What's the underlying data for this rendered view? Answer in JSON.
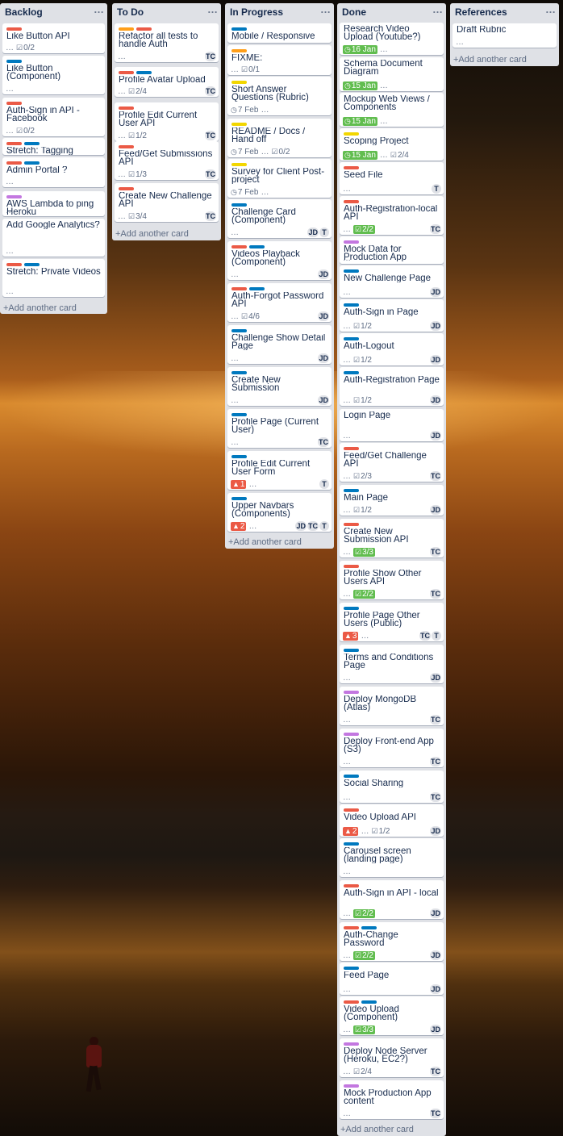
{
  "lists": [
    {
      "title": "Backlog",
      "add_label": "+Add another card",
      "cards": [
        {
          "title": "Like Button API",
          "checklist": "0/2",
          "labels": [
            "red"
          ]
        },
        {
          "title": "Like Button (Component)",
          "labels": [
            "blue"
          ]
        },
        {
          "title": "Auth-Sign in API - Facebook",
          "checklist": "0/2",
          "labels": [
            "red"
          ]
        },
        {
          "title": "Stretch: Tagging",
          "labels": [
            "red",
            "blue"
          ]
        },
        {
          "title": "Admin Portal ?",
          "labels": [
            "red",
            "blue"
          ]
        },
        {
          "title": "AWS Lambda to ping Heroku",
          "labels": [
            "purple"
          ]
        },
        {
          "title": "Add Google Analytics?",
          "labels": []
        },
        {
          "title": "Stretch: Private Videos",
          "labels": [
            "red",
            "blue"
          ]
        }
      ]
    },
    {
      "title": "To Do",
      "add_label": "+Add another card",
      "cards": [
        {
          "title": "Refactor all tests to handle Auth",
          "labels": [
            "orange",
            "red"
          ],
          "members": [
            "TC"
          ]
        },
        {
          "title": "Profile Avatar Upload",
          "checklist": "2/4",
          "labels": [
            "red",
            "blue"
          ],
          "members": [
            "TC"
          ]
        },
        {
          "title": "Profile Edit Current User API",
          "checklist": "1/2",
          "labels": [
            "red"
          ],
          "members": [
            "TC"
          ]
        },
        {
          "title": "Feed/Get Submissions API",
          "checklist": "1/3",
          "labels": [
            "red"
          ],
          "members": [
            "TC"
          ]
        },
        {
          "title": "Create New Challenge API",
          "checklist": "3/4",
          "labels": [
            "red"
          ],
          "members": [
            "TC"
          ]
        }
      ]
    },
    {
      "title": "In Progress",
      "add_label": "+Add another card",
      "cards": [
        {
          "title": "Mobile / Responsive",
          "labels": [
            "blue"
          ]
        },
        {
          "title": "FIXME:",
          "checklist": "0/1",
          "labels": [
            "orange"
          ]
        },
        {
          "title": "Short Answer Questions (Rubric)",
          "due": "7 Feb",
          "labels": [
            "yellow"
          ]
        },
        {
          "title": "README / Docs / Hand off",
          "due": "7 Feb",
          "checklist": "0/2",
          "labels": [
            "yellow"
          ]
        },
        {
          "title": "Survey for Client Post-project",
          "due": "7 Feb",
          "labels": [
            "yellow"
          ]
        },
        {
          "title": "Challenge Card (Component)",
          "labels": [
            "blue"
          ],
          "members": [
            "JD",
            "T"
          ]
        },
        {
          "title": "Videos Playback (Component)",
          "labels": [
            "red",
            "blue"
          ],
          "members": [
            "JD"
          ]
        },
        {
          "title": "Auth-Forgot Password API",
          "checklist": "4/6",
          "labels": [
            "red",
            "blue"
          ],
          "members": [
            "JD"
          ]
        },
        {
          "title": "Challenge Show Detail Page",
          "labels": [
            "blue"
          ],
          "members": [
            "JD"
          ]
        },
        {
          "title": "Create New Submission",
          "labels": [
            "blue"
          ],
          "members": [
            "JD"
          ]
        },
        {
          "title": "Profile Page (Current User)",
          "labels": [
            "blue"
          ],
          "members": [
            "TC"
          ]
        },
        {
          "title": "Profile Edit Current User Form",
          "alert": "1",
          "labels": [
            "blue"
          ],
          "members": [
            "T"
          ]
        },
        {
          "title": "Upper Navbars (Components)",
          "alert": "2",
          "labels": [
            "blue"
          ],
          "members": [
            "JD",
            "TC",
            "T"
          ]
        }
      ]
    },
    {
      "title": "Done",
      "add_label": "+Add another card",
      "cards": [
        {
          "title": "Research Video Upload (Youtube?)",
          "due": "16 Jan",
          "labels": []
        },
        {
          "title": "Schema Document Diagram",
          "due": "15 Jan",
          "labels": []
        },
        {
          "title": "Mockup Web Views / Components",
          "due": "15 Jan",
          "labels": []
        },
        {
          "title": "Scoping Project",
          "due": "15 Jan",
          "checklist": "2/4",
          "labels": [
            "yellow"
          ]
        },
        {
          "title": "Seed File",
          "labels": [
            "red"
          ],
          "members": [
            "T"
          ]
        },
        {
          "title": "Auth-Registration-local API",
          "checklist_done": "2/2",
          "labels": [
            "red"
          ],
          "members": [
            "TC"
          ]
        },
        {
          "title": "Mock Data for Production App",
          "labels": [
            "purple"
          ]
        },
        {
          "title": "New Challenge Page",
          "labels": [
            "blue"
          ],
          "members": [
            "JD"
          ]
        },
        {
          "title": "Auth-Sign in Page",
          "checklist": "1/2",
          "labels": [
            "blue"
          ],
          "members": [
            "JD"
          ]
        },
        {
          "title": "Auth-Logout",
          "checklist": "1/2",
          "labels": [
            "blue"
          ],
          "members": [
            "JD"
          ]
        },
        {
          "title": "Auth-Registration Page",
          "checklist": "1/2",
          "labels": [
            "blue"
          ],
          "members": [
            "JD"
          ]
        },
        {
          "title": "Login Page",
          "labels": [],
          "members": [
            "JD"
          ]
        },
        {
          "title": "Feed/Get Challenge API",
          "checklist": "2/3",
          "labels": [
            "red"
          ],
          "members": [
            "TC"
          ]
        },
        {
          "title": "Main Page",
          "checklist": "1/2",
          "labels": [
            "blue"
          ],
          "members": [
            "JD"
          ]
        },
        {
          "title": "Create New Submission API",
          "checklist_done": "3/3",
          "labels": [
            "red"
          ],
          "members": [
            "TC"
          ]
        },
        {
          "title": "Profile Show Other Users API",
          "checklist_done": "2/2",
          "labels": [
            "red"
          ],
          "members": [
            "TC"
          ]
        },
        {
          "title": "Profile Page Other Users (Public)",
          "alert": "3",
          "labels": [
            "blue"
          ],
          "members": [
            "TC",
            "T"
          ]
        },
        {
          "title": "Terms and Conditions Page",
          "labels": [
            "blue"
          ],
          "members": [
            "JD"
          ]
        },
        {
          "title": "Deploy MongoDB (Atlas)",
          "labels": [
            "purple"
          ],
          "members": [
            "TC"
          ]
        },
        {
          "title": "Deploy Front-end App (S3)",
          "labels": [
            "purple"
          ],
          "members": [
            "TC"
          ]
        },
        {
          "title": "Social Sharing",
          "labels": [
            "blue"
          ],
          "members": [
            "TC"
          ]
        },
        {
          "title": "Video Upload API",
          "alert": "2",
          "checklist": "1/2",
          "labels": [
            "red"
          ],
          "members": [
            "JD"
          ]
        },
        {
          "title": "Carousel screen (landing page)",
          "labels": [
            "blue"
          ]
        },
        {
          "title": "Auth-Sign in API - local",
          "checklist_done": "2/2",
          "labels": [
            "red"
          ],
          "members": [
            "JD"
          ]
        },
        {
          "title": "Auth-Change Password",
          "checklist_done": "2/2",
          "labels": [
            "red",
            "blue"
          ],
          "members": [
            "JD"
          ]
        },
        {
          "title": "Feed Page",
          "labels": [
            "blue"
          ],
          "members": [
            "JD"
          ]
        },
        {
          "title": "Video Upload (Component)",
          "checklist_done": "3/3",
          "labels": [
            "red",
            "blue"
          ],
          "members": [
            "JD"
          ]
        },
        {
          "title": "Deploy Node Server (Heroku, EC2?)",
          "checklist": "2/4",
          "labels": [
            "purple"
          ],
          "members": [
            "TC"
          ]
        },
        {
          "title": "Mock Production App content",
          "labels": [
            "purple"
          ],
          "members": [
            "TC"
          ]
        }
      ]
    },
    {
      "title": "References",
      "add_label": "+Add another card",
      "cards": [
        {
          "title": "Draft Rubric",
          "labels": []
        }
      ]
    }
  ],
  "list_menu_icon": "…",
  "colors": {
    "red": "#eb5a46",
    "blue": "#0079bf",
    "orange": "#ff9f1a",
    "yellow": "#f2d600",
    "purple": "#c377e0",
    "green": "#61bd4f",
    "list_bg": "#dfe1e6"
  }
}
